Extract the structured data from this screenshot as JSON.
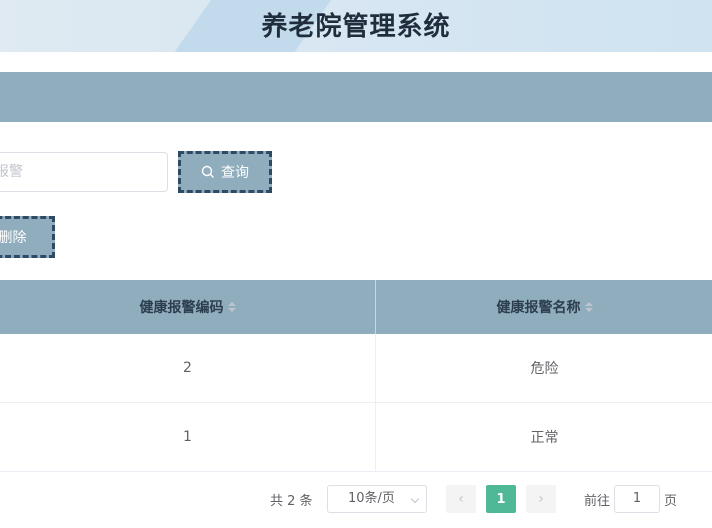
{
  "header": {
    "title": "养老院管理系统"
  },
  "search": {
    "placeholder": "报警",
    "button_label": "查询"
  },
  "toolbar": {
    "delete_label": "删除"
  },
  "table": {
    "columns": [
      "健康报警编码",
      "健康报警名称"
    ],
    "rows": [
      {
        "code": "2",
        "name": "危险"
      },
      {
        "code": "1",
        "name": "正常"
      }
    ]
  },
  "pagination": {
    "total": "共 2 条",
    "page_size": "10条/页",
    "current_page": "1",
    "goto_label": "前往",
    "goto_value": "1",
    "goto_suffix": "页"
  },
  "colors": {
    "accent": "#8fadbd",
    "active_page": "#4fb897",
    "button_border": "#2e4a64"
  }
}
